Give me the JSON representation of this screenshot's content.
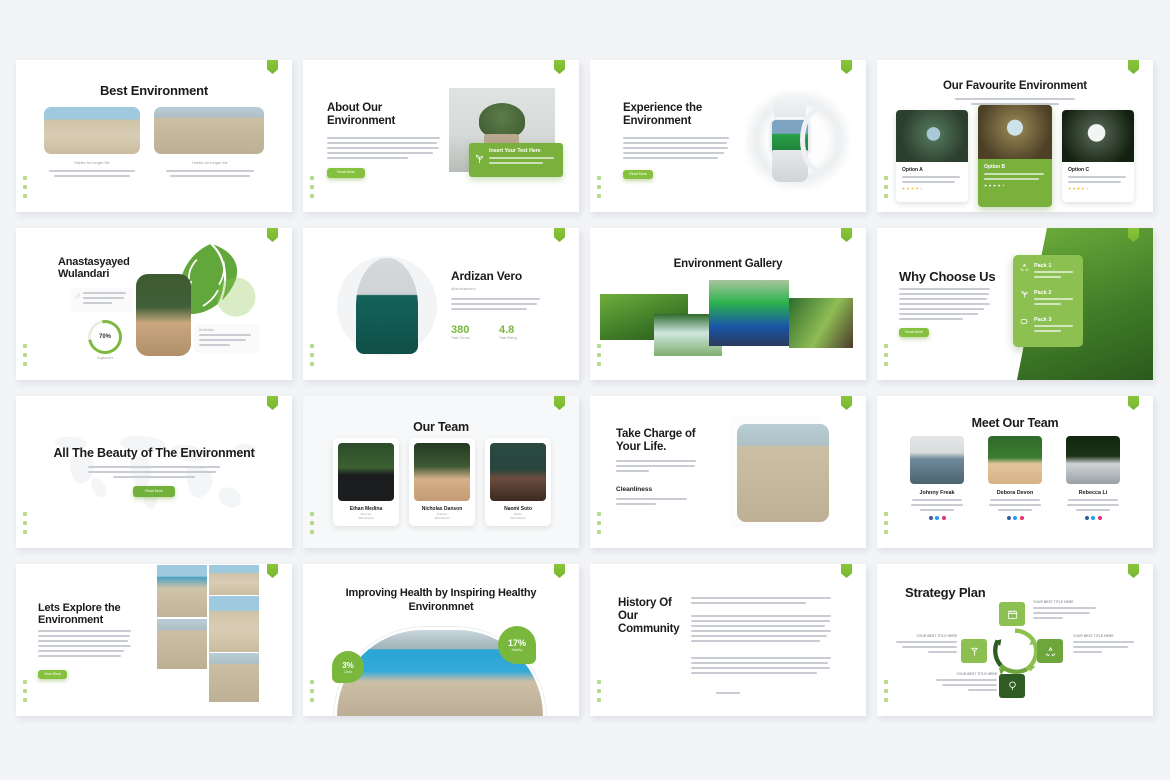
{
  "meta": {
    "background_color": "#f2f4f7",
    "accent_green": "#85c13f",
    "accent_green_dark": "#6aa233",
    "slide_background": "#ffffff",
    "badge_icon": "shield-badge-icon",
    "rail_icons": [
      "facebook-icon",
      "twitter-icon",
      "instagram-icon"
    ],
    "grid": {
      "columns": 4,
      "rows": 4,
      "total_slides": 16
    }
  },
  "lorem": {
    "body": "A wonderful serenity has taken possession of my entire soul, like these sweet mornings of spring which I enjoy with my whole heart. I am alone, and feel the charm of existence in this spot, which was created for the bliss of souls like mine.",
    "short": "The European languages are members of the same family.",
    "card": "A wonderful serenity has taken possession of my entire soul, like these sweet mornings."
  },
  "slides": [
    {
      "id": 1,
      "name": "best-environment",
      "title": "Best Environment",
      "cards": [
        {
          "caption": "Habits for longer life",
          "text": "The European languages are members of the same family."
        },
        {
          "caption": "Habits for longer life",
          "text": "The European languages are members of the same family."
        }
      ]
    },
    {
      "id": 2,
      "name": "about-our-environment",
      "title": "About Our Environment",
      "button": "Read More",
      "callout_title": "Insert Your Text Here",
      "callout_text": "A wonderful serenity has taken possession of my entire soul like these sweet mornings.",
      "callout_icon": "leaf-sprout-icon"
    },
    {
      "id": 3,
      "name": "experience-the-environment",
      "title": "Experience the Environment",
      "button": "Read More",
      "device": "smartwatch-mockup"
    },
    {
      "id": 4,
      "name": "our-favourite-environment",
      "title": "Our Favourite Environment",
      "subtitle": "A wonderful serenity has taken possession of my entire soul, like these sweet mornings of spring which I enjoy with my whole heart.",
      "options": [
        {
          "label": "Option A",
          "text": "A wonderful serenity has taken possession of my entire soul, like these sweet mornings.",
          "rating": 4,
          "highlight": false
        },
        {
          "label": "Option B",
          "text": "A wonderful serenity has taken possession of my entire soul, like these sweet mornings.",
          "rating": 4,
          "highlight": true
        },
        {
          "label": "Option C",
          "text": "A wonderful serenity has taken possession of my entire soul, like these sweet mornings.",
          "rating": 4,
          "highlight": false
        }
      ]
    },
    {
      "id": 5,
      "name": "anastasyayed-wulandari",
      "title": "Anastasyayed Wulandari",
      "note_left": "Lorem ipsum dolor sit amet, consectetur adipiscing elit, sed do eiusmod tempor.",
      "note_right_label": "Dedication",
      "note_right": "Lorem ipsum dolor sit amet, consectetur adipiscing elit.",
      "ring_value": "70%",
      "ring_label": "Organizers",
      "decor": "monstera-leaf-icon"
    },
    {
      "id": 6,
      "name": "ardizan-vero",
      "title": "Ardizan Vero",
      "handle": "@ardizanvero",
      "text": "The European languages are members of the same family. Their separate existence is a myth. For science, music, sport, etc, Europe uses the same vocabulary.",
      "stats": [
        {
          "value": "380",
          "label": "Total Clients"
        },
        {
          "value": "4.8",
          "label": "Total Rating"
        }
      ]
    },
    {
      "id": 7,
      "name": "environment-gallery",
      "title": "Environment Gallery",
      "photo_count": 4
    },
    {
      "id": 8,
      "name": "why-choose-us",
      "title": "Why Choose Us",
      "button": "Read More",
      "packs": [
        {
          "label": "Pack 1",
          "text": "A wonderful serenity has taken possession.",
          "icon": "recycle-icon"
        },
        {
          "label": "Pack 2",
          "text": "A wonderful serenity has taken possession.",
          "icon": "plant-icon"
        },
        {
          "label": "Pack 3",
          "text": "A wonderful serenity has taken possession.",
          "icon": "battery-eco-icon"
        }
      ]
    },
    {
      "id": 9,
      "name": "all-the-beauty-of-the-environment",
      "title": "All The Beauty of The Environment",
      "subtitle": "A wonderful serenity has taken possession of my entire soul, like these sweet mornings of spring which I enjoy with my whole heart. I am alone, and feel the charm of existence in this spot.",
      "button": "Read More",
      "decor": "world-map-icon"
    },
    {
      "id": 10,
      "name": "our-team",
      "title": "Our Team",
      "members": [
        {
          "name": "Ethan Medina",
          "role": "Director",
          "meta": "480 Clients"
        },
        {
          "name": "Nicholas Danson",
          "role": "Teacher",
          "meta": "320 Clients"
        },
        {
          "name": "Naomi Soto",
          "role": "Writer",
          "meta": "220 Clients"
        }
      ]
    },
    {
      "id": 11,
      "name": "take-charge-of-your-life",
      "title": "Take Charge of Your Life.",
      "text": "Lorem ipsum dolor sit amet, consectetur adipiscing elit, sed do eiusmod tempor incididunt.",
      "subheading": "Cleanliness",
      "subtext": "The European languages are members of the same family."
    },
    {
      "id": 12,
      "name": "meet-our-team",
      "title": "Meet Our Team",
      "members": [
        {
          "name": "Johnny Freak",
          "text": "A wonderful serenity has taken possession of my entire soul, like these sweet mornings."
        },
        {
          "name": "Debora Devon",
          "text": "A wonderful serenity has taken possession of my entire soul, like these sweet mornings."
        },
        {
          "name": "Rebecca Li",
          "text": "A wonderful serenity has taken possession of my entire soul, like these sweet mornings."
        }
      ],
      "social_colors": [
        "#3b5998",
        "#1da1f2",
        "#e1306c"
      ]
    },
    {
      "id": 13,
      "name": "lets-explore-the-environment",
      "title": "Lets Explore the Environment",
      "text": "A wonderful serenity has taken possession of my entire soul, like these sweet mornings of spring which I enjoy with my whole heart. I am alone, and feel the charm of existence in this spot.",
      "button": "View More",
      "photo_count": 5
    },
    {
      "id": 14,
      "name": "improving-health-by-inspiring-healthy-environmnet",
      "title": "Improving Health by Inspiring Healthy Environmnet",
      "bubbles": [
        {
          "value": "3%",
          "label": "Clean"
        },
        {
          "value": "17%",
          "label": "Healthy"
        }
      ]
    },
    {
      "id": 15,
      "name": "history-of-our-community",
      "title": "History Of Our Community",
      "paragraphs": [
        "The European languages are members of the same family. Their separate existence is a myth. For science, music, sport, etc, Europe uses the same vocabulary.",
        "The languages only differ in their grammar, their pronunciation and their most common words. Everyone realizes why a new common language would be desirable: one could refuse to pay expensive translators. To achieve this, it would be necessary to have uniform grammar, pronunciation and more common words. If several languages coalesce, the grammar of the resulting language is more simple and regular than that of the individual languages.",
        "The new common language will be more simple and regular than the existing European languages. It will be as simple as Occidental in fact. It will be Occidental to an English person. It will seem like simplified English, as a skeptical Cambridge friend of mine told me what Occidental is."
      ]
    },
    {
      "id": 16,
      "name": "strategy-plan",
      "title": "Strategy Plan",
      "nodes": [
        {
          "title": "YOUR BEST TITLE HERE",
          "text": "A wonderful serenity has taken possession of my entire soul, like these sweet mornings.",
          "icon": "calendar-icon"
        },
        {
          "title": "YOUR BEST TITLE HERE",
          "text": "A wonderful serenity has taken possession of my entire soul, like these sweet mornings.",
          "icon": "recycle-icon"
        },
        {
          "title": "YOUR BEST TITLE HERE",
          "text": "A wonderful serenity has taken possession of my entire soul, like these sweet mornings.",
          "icon": "globe-leaf-icon"
        },
        {
          "title": "YOUR BEST TITLE HERE",
          "text": "A wonderful serenity has taken possession of my entire soul, like these sweet mornings.",
          "icon": "tree-icon"
        }
      ]
    }
  ]
}
